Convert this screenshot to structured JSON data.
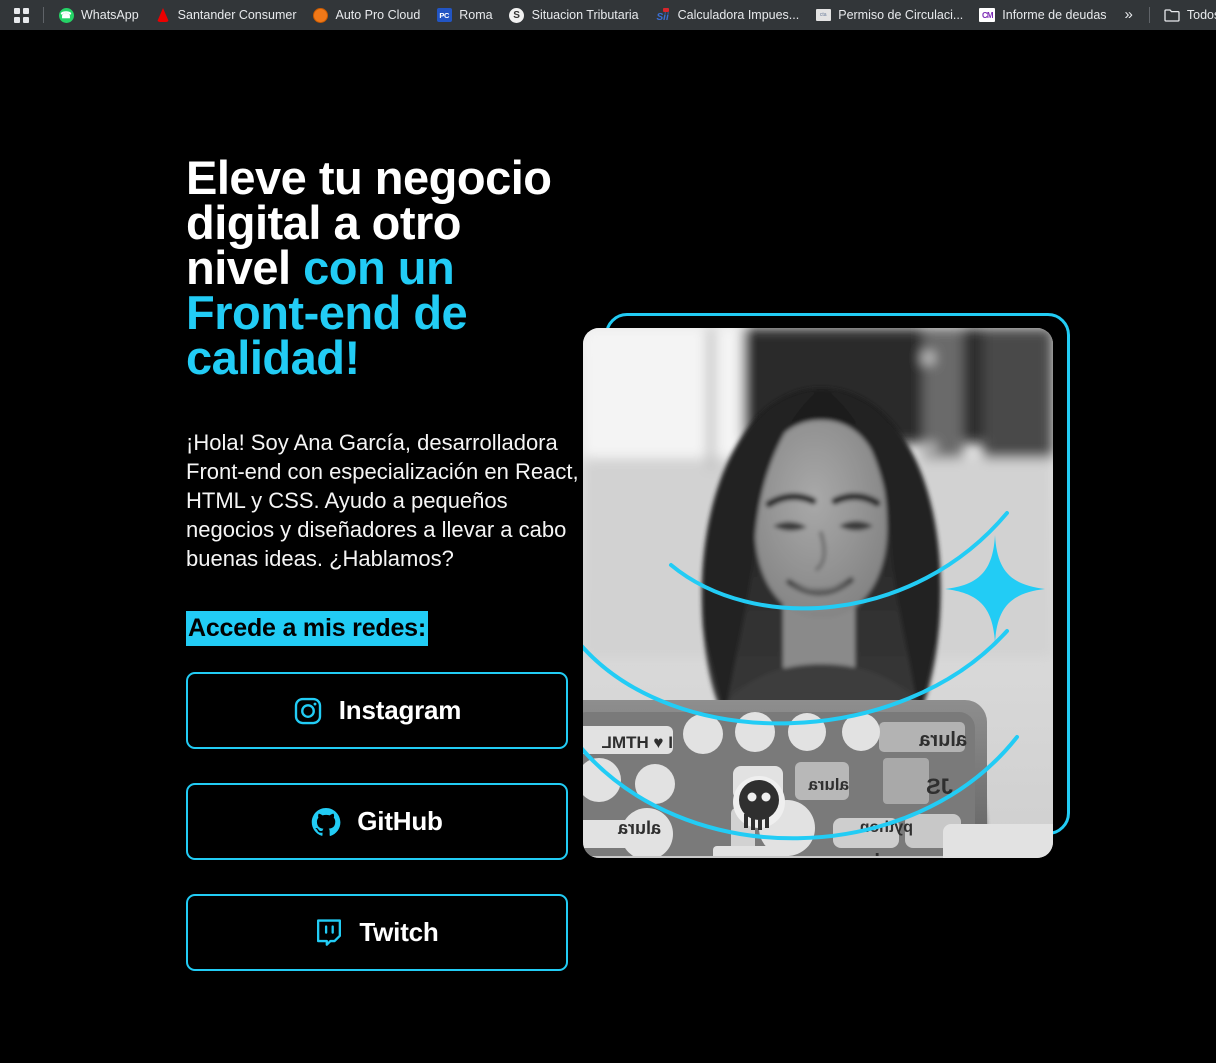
{
  "browser": {
    "apps_grid_icon": "apps-grid-icon",
    "overflow_label": "»",
    "bookmarks": [
      {
        "label": "WhatsApp",
        "icon": "whatsapp-icon",
        "glyph": "✆"
      },
      {
        "label": "Santander Consumer",
        "icon": "santander-icon",
        "glyph": ""
      },
      {
        "label": "Auto Pro Cloud",
        "icon": "autoprocloud-icon",
        "glyph": ""
      },
      {
        "label": "Roma",
        "icon": "roma-icon",
        "glyph": "PC"
      },
      {
        "label": "Situacion Tributaria",
        "icon": "situacion-icon",
        "glyph": "S"
      },
      {
        "label": "Calculadora Impues...",
        "icon": "sii-icon",
        "glyph": "Sii"
      },
      {
        "label": "Permiso de Circulaci...",
        "icon": "permiso-icon",
        "glyph": "cta"
      },
      {
        "label": "Informe de deudas",
        "icon": "informe-icon",
        "glyph": "CM"
      }
    ],
    "all_bookmarks_label": "Todos los",
    "all_bookmarks_icon": "folder-icon"
  },
  "hero": {
    "headline": {
      "line1": "Eleve tu negocio",
      "line2": "digital a otro",
      "line3_plain": "nivel ",
      "line3_accent": "con un",
      "line4_accent": "Front-end de",
      "line5_accent": "calidad!"
    },
    "bio": "¡Hola! Soy Ana García, desarrolladora Front-end con especialización en React, HTML y CSS. Ayudo a pequeños negocios y diseñadores a llevar a cabo buenas ideas. ¿Hablamos?",
    "networks_heading": "Accede a mis redes:",
    "buttons": [
      {
        "label": "Instagram",
        "icon": "instagram-icon"
      },
      {
        "label": "GitHub",
        "icon": "github-icon"
      },
      {
        "label": "Twitch",
        "icon": "twitch-icon"
      }
    ],
    "image_alt": "developer-photo",
    "decorations": [
      "sparkle-icon",
      "arc-decoration",
      "frame-decoration"
    ]
  },
  "colors": {
    "accent": "#22CCF5",
    "background": "#000000",
    "text": "#FFFFFF",
    "browser_bar": "#323639"
  }
}
